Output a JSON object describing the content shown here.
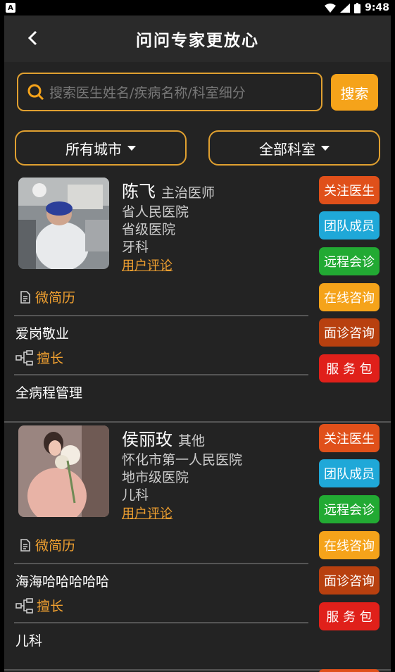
{
  "status": {
    "time": "9:48",
    "notif_icon": "A"
  },
  "header": {
    "title": "问问专家更放心"
  },
  "search": {
    "placeholder": "搜索医生姓名/疾病名称/科室细分",
    "button": "搜索"
  },
  "filters": {
    "city": "所有城市",
    "department": "全部科室"
  },
  "doctors": [
    {
      "name": "陈飞",
      "title": "主治医师",
      "hospital": "省人民医院",
      "level": "省级医院",
      "dept": "牙科",
      "review": "用户评论",
      "resume": "微简历",
      "motto": "爱岗敬业",
      "skill_label": "擅长",
      "skill": "全病程管理"
    },
    {
      "name": "侯丽玫",
      "title": "其他",
      "hospital": "怀化市第一人民医院",
      "level": "地市级医院",
      "dept": "儿科",
      "review": "用户评论",
      "resume": "微简历",
      "motto": "海海哈哈哈哈哈",
      "skill_label": "擅长",
      "skill": "儿科"
    }
  ],
  "actions": {
    "follow": "关注医生",
    "team": "团队成员",
    "remote": "远程会诊",
    "online": "在线咨询",
    "face": "面诊咨询",
    "package": "服 务 包"
  },
  "colors": {
    "accent": "#f5a31a",
    "follow": "#e0501a",
    "team": "#1fa8d8",
    "remote": "#22aa33",
    "face": "#b8400f",
    "package": "#e0201a"
  }
}
